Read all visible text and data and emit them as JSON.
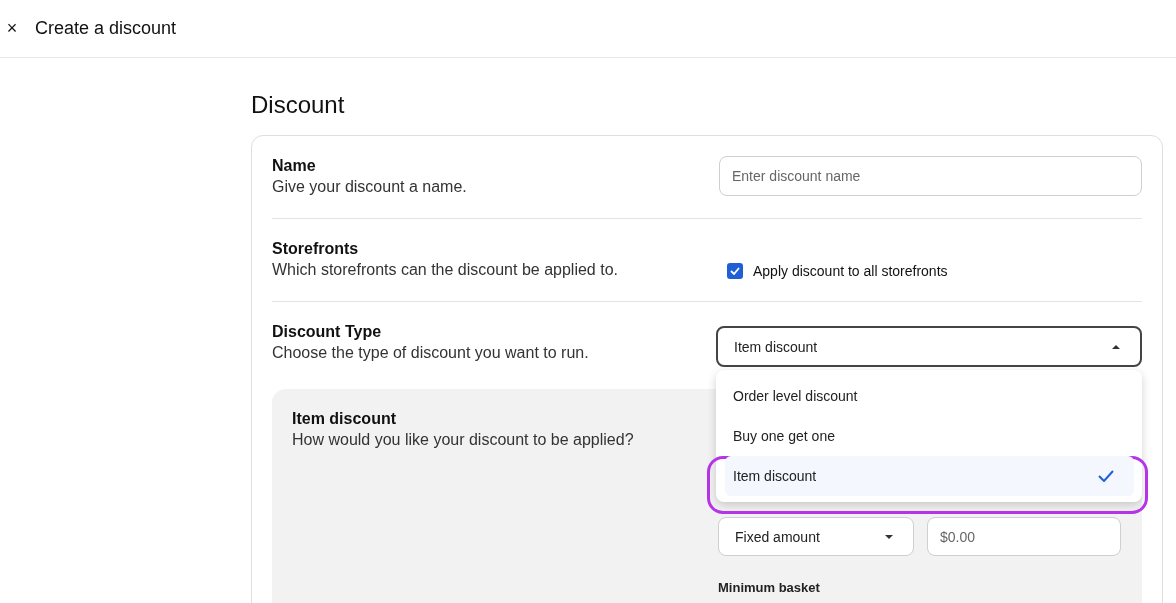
{
  "header": {
    "title": "Create a discount",
    "close_glyph": "×"
  },
  "section_title": "Discount",
  "name_row": {
    "label": "Name",
    "description": "Give your discount a name.",
    "placeholder": "Enter discount name"
  },
  "storefronts_row": {
    "label": "Storefronts",
    "description": "Which storefronts can the discount be applied to.",
    "checkbox_label": "Apply discount to all storefronts",
    "checked": true
  },
  "discount_type_row": {
    "label": "Discount Type",
    "description": "Choose the type of discount you want to run.",
    "value": "Item discount",
    "expanded": true,
    "options": [
      {
        "label": "Order level discount",
        "selected": false
      },
      {
        "label": "Buy one get one",
        "selected": false
      },
      {
        "label": "Item discount",
        "selected": true
      }
    ]
  },
  "item_discount_panel": {
    "title": "Item discount",
    "description": "How would you like your discount to be applied?",
    "type_value": "Fixed amount",
    "amount_placeholder": "$0.00",
    "minimum_basket_label": "Minimum basket"
  }
}
